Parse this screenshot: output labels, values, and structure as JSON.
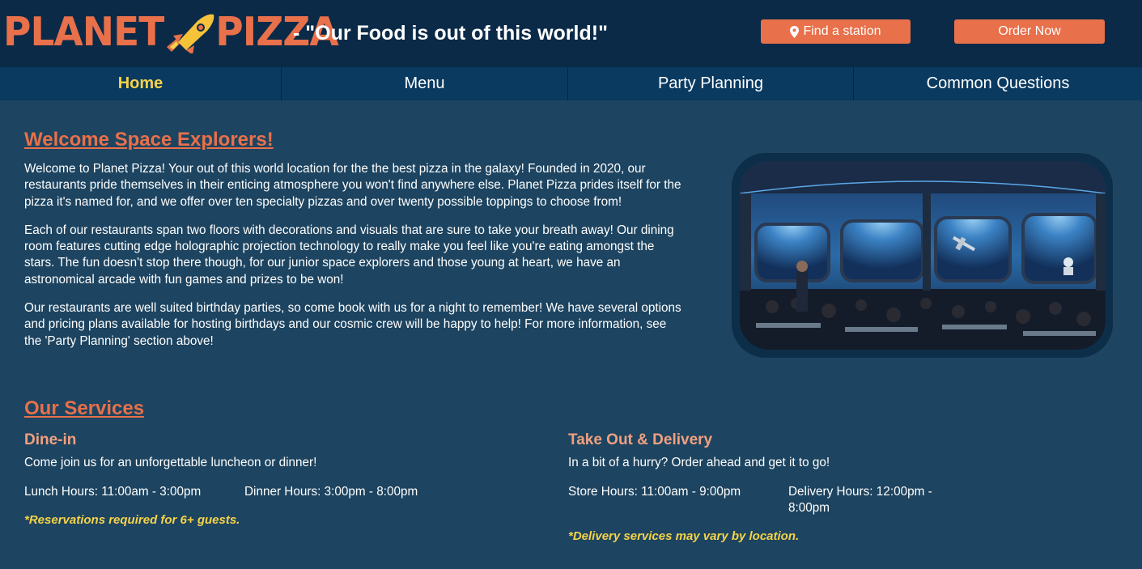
{
  "header": {
    "logo": {
      "word1": "PLANET",
      "word2": "PIZZA",
      "icon": "rocket-icon"
    },
    "tagline": "- \"Our Food is out of this world!\"",
    "find_station_label": "Find a station",
    "order_now_label": "Order Now"
  },
  "nav": {
    "items": [
      {
        "label": "Home",
        "active": true
      },
      {
        "label": "Menu",
        "active": false
      },
      {
        "label": "Party Planning",
        "active": false
      },
      {
        "label": "Common Questions",
        "active": false
      }
    ]
  },
  "welcome": {
    "title": "Welcome Space Explorers!",
    "paragraphs": [
      "Welcome to Planet Pizza! Your out of this world location for the the best pizza in the galaxy! Founded in 2020, our restaurants pride themselves in their enticing atmosphere you won't find anywhere else. Planet Pizza prides itself for the pizza it's named for, and we offer over ten specialty pizzas and over twenty possible toppings to choose from!",
      "Each of our restaurants span two floors with decorations and visuals that are sure to take your breath away! Our dining room features cutting edge holographic projection technology to really make you feel like you're eating amongst the stars. The fun doesn't stop there though, for our junior space explorers and those young at heart, we have an astronomical arcade with fun games and prizes to be won!",
      "Our restaurants are well suited birthday parties, so come book with us for a night to remember! We have several options and pricing plans available for hosting birthdays and our cosmic crew will be happy to help! For more information, see the 'Party Planning' section above!"
    ]
  },
  "services": {
    "title": "Our Services",
    "dine_in": {
      "heading": "Dine-in",
      "description": "Come join us for an unforgettable luncheon or dinner!",
      "lunch_hours": "Lunch Hours: 11:00am - 3:00pm",
      "dinner_hours": "Dinner Hours: 3:00pm - 8:00pm",
      "note": "*Reservations required for 6+ guests."
    },
    "takeout": {
      "heading": "Take Out & Delivery",
      "description": "In a bit of a hurry? Order ahead and get it to go!",
      "store_hours": "Store Hours: 11:00am - 9:00pm",
      "delivery_hours": "Delivery Hours: 12:00pm - 8:00pm",
      "note": "*Delivery services may vary by location."
    }
  },
  "colors": {
    "background": "#1d4460",
    "header_bg": "#0a2a48",
    "nav_bg": "#0a3a60",
    "accent": "#e8704a",
    "active_nav": "#f5d34a",
    "subheading": "#f0a080"
  }
}
